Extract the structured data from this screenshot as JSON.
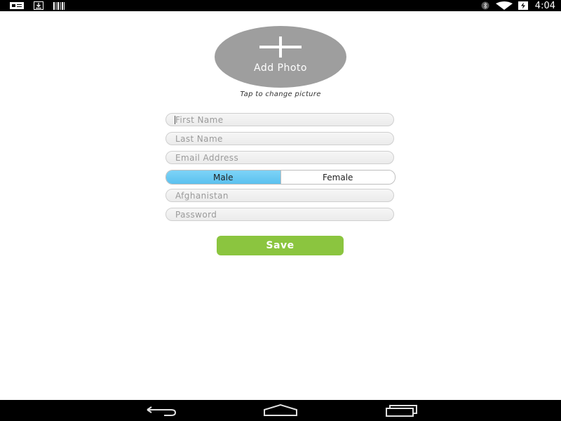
{
  "status_bar": {
    "time": "4:04",
    "left_icons": [
      "notification-card-icon",
      "download-icon",
      "barcode-icon"
    ],
    "right_icons": [
      "bluetooth-icon",
      "wifi-icon",
      "battery-charging-icon"
    ]
  },
  "profile": {
    "add_photo_label": "Add Photo",
    "tap_hint": "Tap to change picture"
  },
  "form": {
    "first_name": {
      "value": "",
      "placeholder": "First Name"
    },
    "last_name": {
      "value": "",
      "placeholder": "Last Name"
    },
    "email": {
      "value": "",
      "placeholder": "Email Address"
    },
    "gender": {
      "options": [
        "Male",
        "Female"
      ],
      "selected": "Male"
    },
    "country": {
      "value": "Afghanistan"
    },
    "password": {
      "value": "",
      "placeholder": "Password"
    },
    "save_label": "Save"
  },
  "nav_bar": {
    "buttons": [
      "back-icon",
      "home-icon",
      "recents-icon"
    ]
  },
  "colors": {
    "photo_circle": "#9e9e9e",
    "gender_selected": "#5bc1ef",
    "save_button": "#8bc53f"
  }
}
